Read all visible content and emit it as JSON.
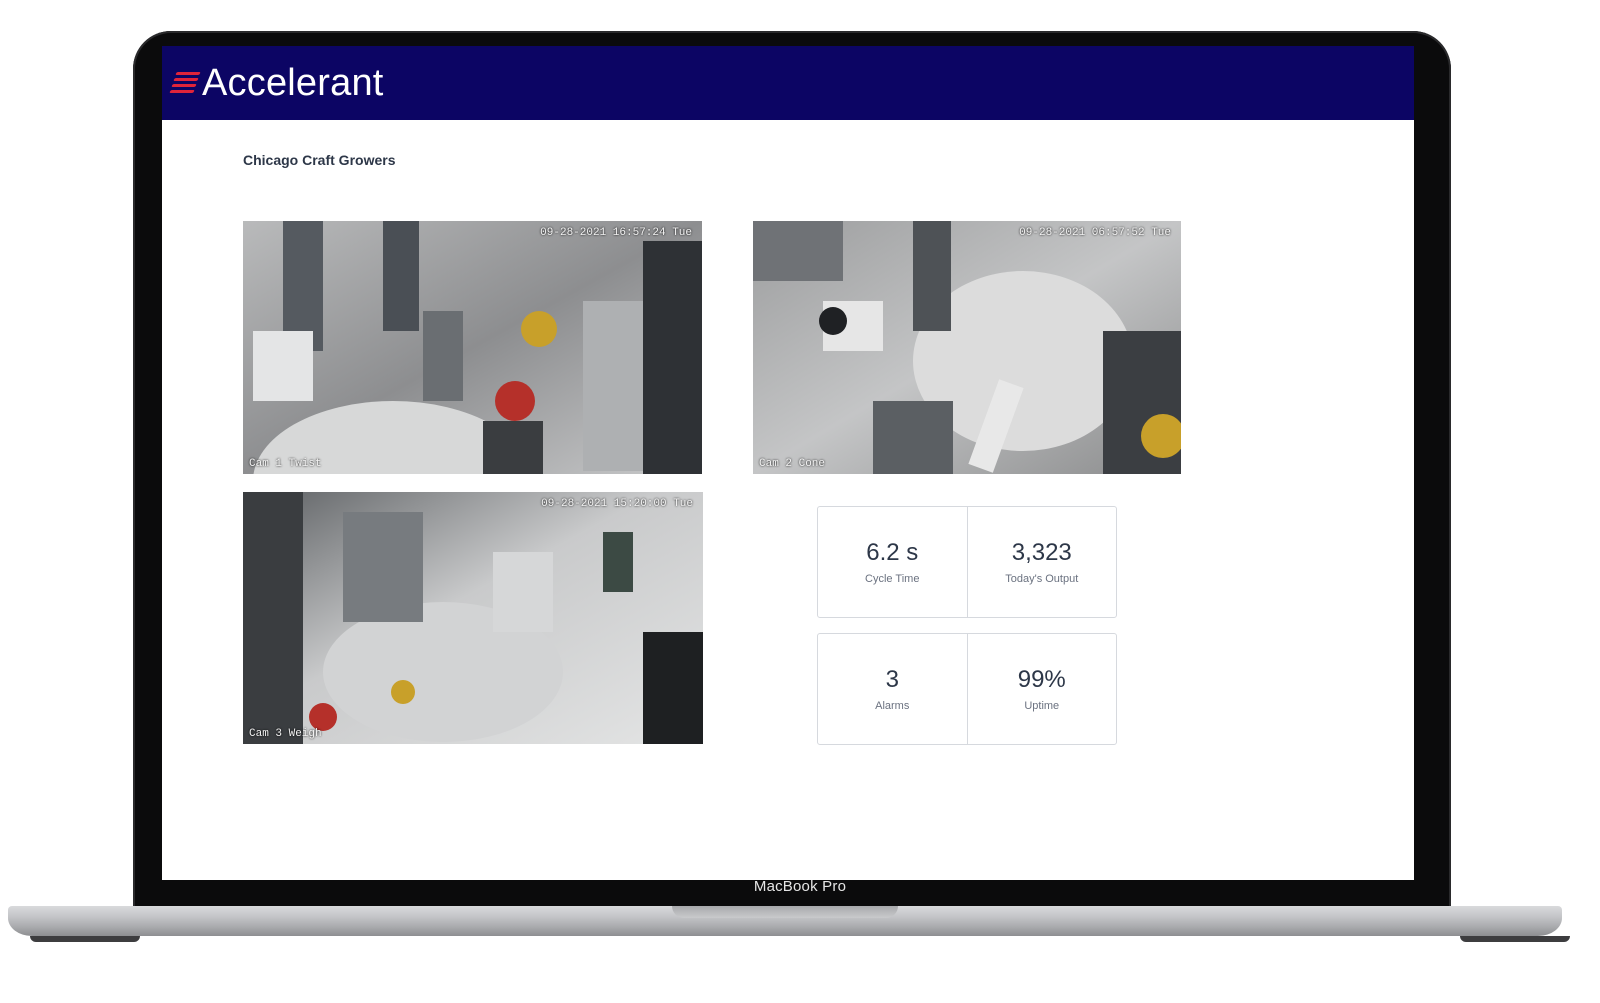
{
  "device": {
    "label": "MacBook Pro"
  },
  "app": {
    "brand": "Accelerant",
    "brand_color": "#0c0564",
    "accent_color": "#e0243a"
  },
  "page": {
    "title": "Chicago Craft Growers"
  },
  "cameras": [
    {
      "timestamp": "09-28-2021 16:57:24 Tue",
      "label": "Cam 1 Twist"
    },
    {
      "timestamp": "09-28-2021 06:57:52 Tue",
      "label": "Cam 2 Cone"
    },
    {
      "timestamp": "09-28-2021 15:20:00 Tue",
      "label": "Cam 3 Weigh"
    }
  ],
  "stats": [
    {
      "value": "6.2 s",
      "label": "Cycle Time"
    },
    {
      "value": "3,323",
      "label": "Today's Output"
    },
    {
      "value": "3",
      "label": "Alarms"
    },
    {
      "value": "99%",
      "label": "Uptime"
    }
  ]
}
